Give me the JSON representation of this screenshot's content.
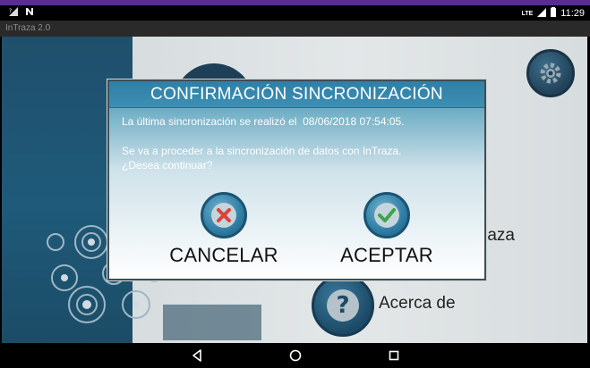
{
  "status_bar": {
    "left_icons": [
      "signal-no-sim-icon",
      "n-notification-icon"
    ],
    "network_label": "LTE",
    "battery_icon": "battery-icon",
    "time": "11:29"
  },
  "app": {
    "title": "InTraza 2.0"
  },
  "menu": {
    "sync_label_partial": "raza",
    "about_label": "Acerca de"
  },
  "dialog": {
    "title": "CONFIRMACIÓN SINCRONIZACIÓN",
    "message_last_sync": "La última sincronización se realizó el  08/06/2018 07:54:05.",
    "message_proceed_line1": "Se va a proceder a la sincronización de datos con InTraza.",
    "message_proceed_line2": "¿Desea continuar?",
    "cancel_label": "CANCELAR",
    "accept_label": "ACEPTAR",
    "colors": {
      "header": "#3d8fb4",
      "cancel_icon": "#d9443b",
      "accept_icon": "#3aa54a"
    }
  },
  "nav_bar": {
    "back_icon": "back-triangle-icon",
    "home_icon": "home-circle-icon",
    "recents_icon": "recents-square-icon"
  }
}
